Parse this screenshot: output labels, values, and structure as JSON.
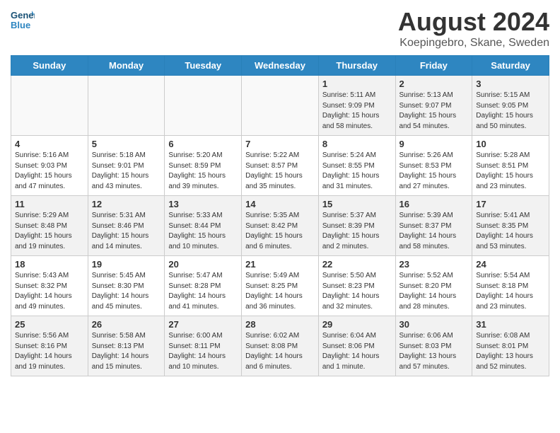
{
  "header": {
    "logo_line1": "General",
    "logo_line2": "Blue",
    "month_year": "August 2024",
    "location": "Koepingebro, Skane, Sweden"
  },
  "days_of_week": [
    "Sunday",
    "Monday",
    "Tuesday",
    "Wednesday",
    "Thursday",
    "Friday",
    "Saturday"
  ],
  "weeks": [
    [
      {
        "day": "",
        "info": "",
        "empty": true
      },
      {
        "day": "",
        "info": "",
        "empty": true
      },
      {
        "day": "",
        "info": "",
        "empty": true
      },
      {
        "day": "",
        "info": "",
        "empty": true
      },
      {
        "day": "1",
        "info": "Sunrise: 5:11 AM\nSunset: 9:09 PM\nDaylight: 15 hours\nand 58 minutes."
      },
      {
        "day": "2",
        "info": "Sunrise: 5:13 AM\nSunset: 9:07 PM\nDaylight: 15 hours\nand 54 minutes."
      },
      {
        "day": "3",
        "info": "Sunrise: 5:15 AM\nSunset: 9:05 PM\nDaylight: 15 hours\nand 50 minutes."
      }
    ],
    [
      {
        "day": "4",
        "info": "Sunrise: 5:16 AM\nSunset: 9:03 PM\nDaylight: 15 hours\nand 47 minutes."
      },
      {
        "day": "5",
        "info": "Sunrise: 5:18 AM\nSunset: 9:01 PM\nDaylight: 15 hours\nand 43 minutes."
      },
      {
        "day": "6",
        "info": "Sunrise: 5:20 AM\nSunset: 8:59 PM\nDaylight: 15 hours\nand 39 minutes."
      },
      {
        "day": "7",
        "info": "Sunrise: 5:22 AM\nSunset: 8:57 PM\nDaylight: 15 hours\nand 35 minutes."
      },
      {
        "day": "8",
        "info": "Sunrise: 5:24 AM\nSunset: 8:55 PM\nDaylight: 15 hours\nand 31 minutes."
      },
      {
        "day": "9",
        "info": "Sunrise: 5:26 AM\nSunset: 8:53 PM\nDaylight: 15 hours\nand 27 minutes."
      },
      {
        "day": "10",
        "info": "Sunrise: 5:28 AM\nSunset: 8:51 PM\nDaylight: 15 hours\nand 23 minutes."
      }
    ],
    [
      {
        "day": "11",
        "info": "Sunrise: 5:29 AM\nSunset: 8:48 PM\nDaylight: 15 hours\nand 19 minutes."
      },
      {
        "day": "12",
        "info": "Sunrise: 5:31 AM\nSunset: 8:46 PM\nDaylight: 15 hours\nand 14 minutes."
      },
      {
        "day": "13",
        "info": "Sunrise: 5:33 AM\nSunset: 8:44 PM\nDaylight: 15 hours\nand 10 minutes."
      },
      {
        "day": "14",
        "info": "Sunrise: 5:35 AM\nSunset: 8:42 PM\nDaylight: 15 hours\nand 6 minutes."
      },
      {
        "day": "15",
        "info": "Sunrise: 5:37 AM\nSunset: 8:39 PM\nDaylight: 15 hours\nand 2 minutes."
      },
      {
        "day": "16",
        "info": "Sunrise: 5:39 AM\nSunset: 8:37 PM\nDaylight: 14 hours\nand 58 minutes."
      },
      {
        "day": "17",
        "info": "Sunrise: 5:41 AM\nSunset: 8:35 PM\nDaylight: 14 hours\nand 53 minutes."
      }
    ],
    [
      {
        "day": "18",
        "info": "Sunrise: 5:43 AM\nSunset: 8:32 PM\nDaylight: 14 hours\nand 49 minutes."
      },
      {
        "day": "19",
        "info": "Sunrise: 5:45 AM\nSunset: 8:30 PM\nDaylight: 14 hours\nand 45 minutes."
      },
      {
        "day": "20",
        "info": "Sunrise: 5:47 AM\nSunset: 8:28 PM\nDaylight: 14 hours\nand 41 minutes."
      },
      {
        "day": "21",
        "info": "Sunrise: 5:49 AM\nSunset: 8:25 PM\nDaylight: 14 hours\nand 36 minutes."
      },
      {
        "day": "22",
        "info": "Sunrise: 5:50 AM\nSunset: 8:23 PM\nDaylight: 14 hours\nand 32 minutes."
      },
      {
        "day": "23",
        "info": "Sunrise: 5:52 AM\nSunset: 8:20 PM\nDaylight: 14 hours\nand 28 minutes."
      },
      {
        "day": "24",
        "info": "Sunrise: 5:54 AM\nSunset: 8:18 PM\nDaylight: 14 hours\nand 23 minutes."
      }
    ],
    [
      {
        "day": "25",
        "info": "Sunrise: 5:56 AM\nSunset: 8:16 PM\nDaylight: 14 hours\nand 19 minutes."
      },
      {
        "day": "26",
        "info": "Sunrise: 5:58 AM\nSunset: 8:13 PM\nDaylight: 14 hours\nand 15 minutes."
      },
      {
        "day": "27",
        "info": "Sunrise: 6:00 AM\nSunset: 8:11 PM\nDaylight: 14 hours\nand 10 minutes."
      },
      {
        "day": "28",
        "info": "Sunrise: 6:02 AM\nSunset: 8:08 PM\nDaylight: 14 hours\nand 6 minutes."
      },
      {
        "day": "29",
        "info": "Sunrise: 6:04 AM\nSunset: 8:06 PM\nDaylight: 14 hours\nand 1 minute."
      },
      {
        "day": "30",
        "info": "Sunrise: 6:06 AM\nSunset: 8:03 PM\nDaylight: 13 hours\nand 57 minutes."
      },
      {
        "day": "31",
        "info": "Sunrise: 6:08 AM\nSunset: 8:01 PM\nDaylight: 13 hours\nand 52 minutes."
      }
    ]
  ]
}
